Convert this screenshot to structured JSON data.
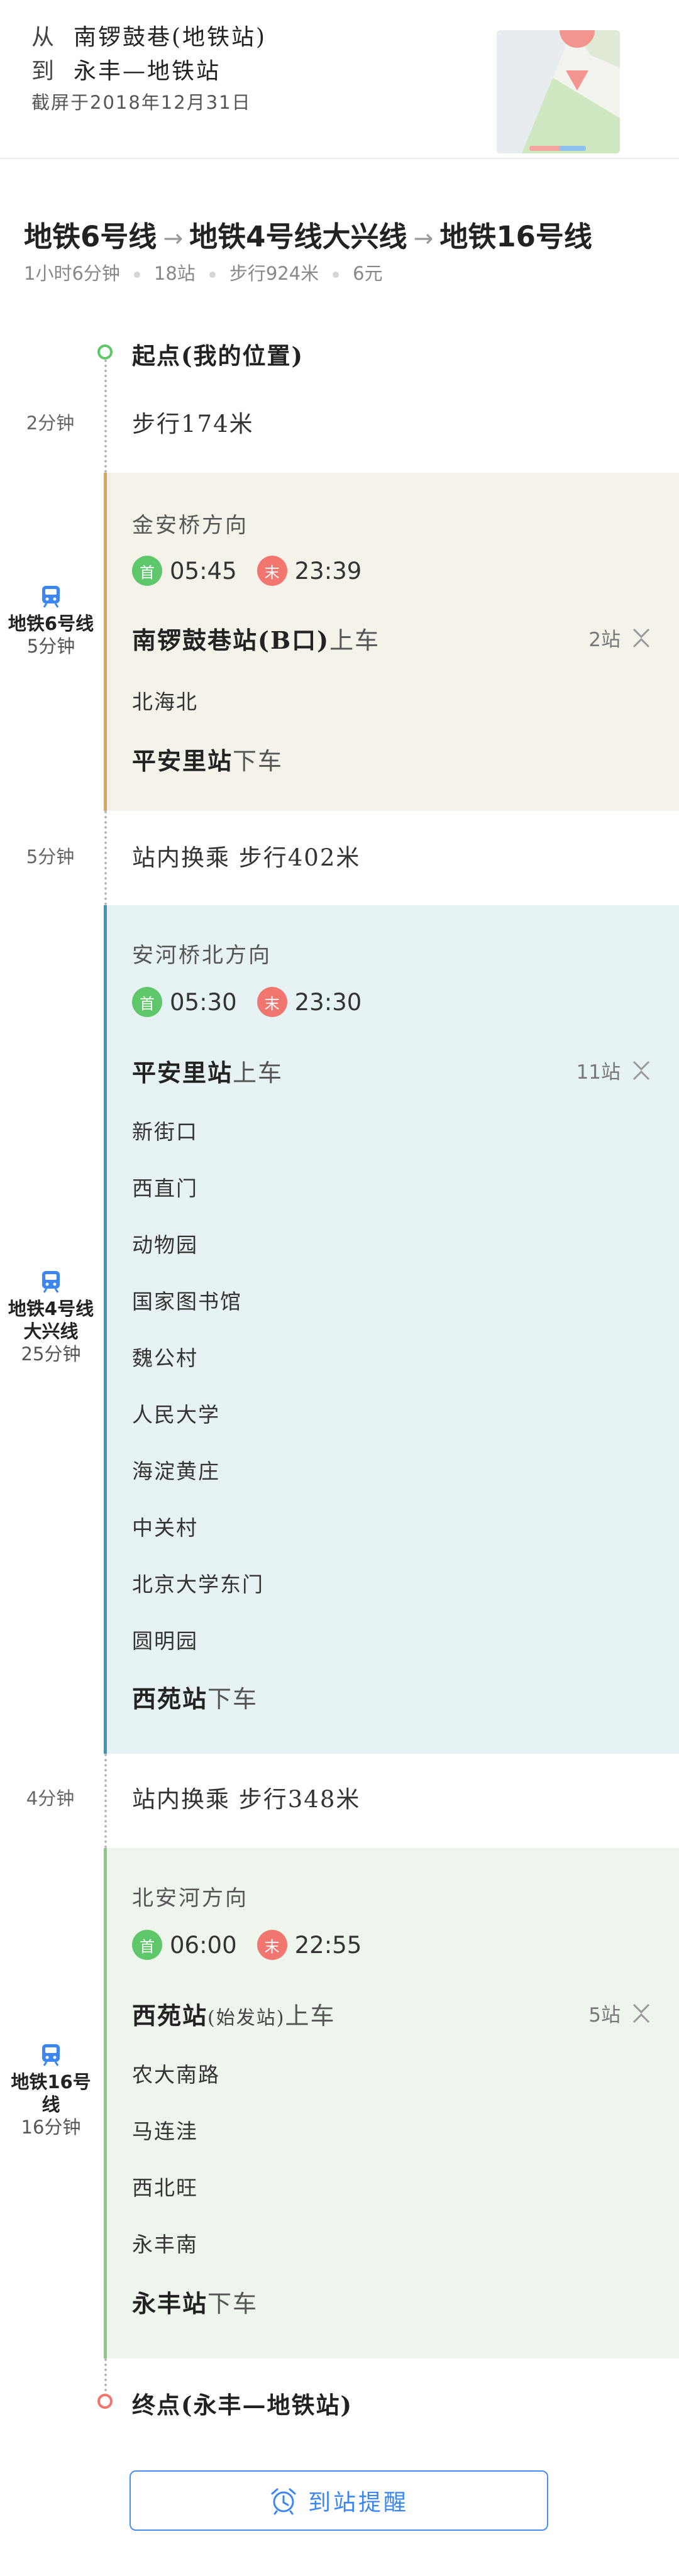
{
  "header": {
    "from_label": "从",
    "from_value": "南锣鼓巷(地铁站)",
    "to_label": "到",
    "to_value": "永丰—地铁站",
    "screenshot_time": "截屏于2018年12月31日"
  },
  "route": {
    "lines": [
      "地铁6号线",
      "地铁4号线大兴线",
      "地铁16号线"
    ],
    "total_time": "1小时6分钟",
    "stops": "18站",
    "walk": "步行924米",
    "price": "6元"
  },
  "start": {
    "label": "起点(我的位置)"
  },
  "walk1": {
    "duration": "2分钟",
    "text": "步行174米"
  },
  "segments": [
    {
      "line_name": "地铁6号线",
      "duration": "5分钟",
      "direction": "金安桥方向",
      "first_badge": "首",
      "first_time": "05:45",
      "last_badge": "末",
      "last_time": "23:39",
      "board_station": "南锣鼓巷站(B口)",
      "board_action": "上车",
      "stop_count": "2站",
      "stations": [
        "北海北"
      ],
      "alight_station": "平安里站",
      "alight_action": "下车",
      "color": "#d7a85a",
      "bg": "#f5f2ea"
    },
    {
      "line_name": "地铁4号线大兴线",
      "duration": "25分钟",
      "direction": "安河桥北方向",
      "first_badge": "首",
      "first_time": "05:30",
      "last_badge": "末",
      "last_time": "23:30",
      "board_station": "平安里站",
      "board_action": "上车",
      "stop_count": "11站",
      "stations": [
        "新街口",
        "西直门",
        "动物园",
        "国家图书馆",
        "魏公村",
        "人民大学",
        "海淀黄庄",
        "中关村",
        "北京大学东门",
        "圆明园"
      ],
      "alight_station": "西苑站",
      "alight_action": "下车",
      "color": "#3e98b4",
      "bg": "#e7f2f4"
    },
    {
      "line_name": "地铁16号线",
      "duration": "16分钟",
      "direction": "北安河方向",
      "first_badge": "首",
      "first_time": "06:00",
      "last_badge": "末",
      "last_time": "22:55",
      "board_station": "西苑站",
      "board_note": "(始发站)",
      "board_action": "上车",
      "stop_count": "5站",
      "stations": [
        "农大南路",
        "马连洼",
        "西北旺",
        "永丰南"
      ],
      "alight_station": "永丰站",
      "alight_action": "下车",
      "color": "#8dc98a",
      "bg": "#eef5ec"
    }
  ],
  "transfer1": {
    "duration": "5分钟",
    "text": "站内换乘  步行402米"
  },
  "transfer2": {
    "duration": "4分钟",
    "text": "站内换乘  步行348米"
  },
  "end": {
    "label": "终点(永丰—地铁站)"
  },
  "remind_button": {
    "label": "到站提醒"
  },
  "colors": {
    "start_dot": "#5ec76a",
    "end_dot": "#f0766f",
    "accent": "#3c86f0"
  }
}
